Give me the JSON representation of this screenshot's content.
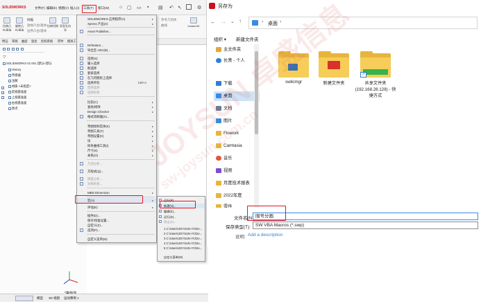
{
  "solidworks": {
    "logo": "SOLIDWORKS",
    "menu": [
      "文件(F)",
      "编辑(E)",
      "视图(V)",
      "插入(I)",
      "工具(T)",
      "窗口(W)"
    ],
    "toolbar": [
      "拉伸凸台/基体",
      "旋转凸台/基体",
      "扫描",
      "放样凸台/基体",
      "边界凸台/基体",
      "拉伸切除",
      "异型孔向导",
      "旋转切除",
      "扫描切除",
      "参考几何体",
      "曲线",
      "Instant3D"
    ],
    "tabs": [
      "特征",
      "草图",
      "曲面",
      "钣金",
      "结构系统",
      "焊件",
      "模具工具",
      "评估"
    ],
    "tree": [
      "SOLIDWORKS 01 001 (默认<默认",
      "History",
      "传感器",
      "注解",
      "材质 <未指定>",
      "前视基准面",
      "上视基准面",
      "右视基准面",
      "原点"
    ],
    "bottom_tabs": [
      "模型",
      "3D 视图",
      "运动算例 1"
    ],
    "axis_label": "*等轴测"
  },
  "tools_menu": {
    "items": [
      {
        "label": "SOLIDWORKS 应用程序(A)",
        "arrow": true
      },
      {
        "label": "Xpress 产品(X)",
        "arrow": true
      },
      {
        "label": "Asset Publisher..."
      },
      {
        "label": "Defeature..."
      },
      {
        "label": "导出至 AEC(B)..."
      },
      {
        "label": "选择(S)"
      },
      {
        "label": "输入选择"
      },
      {
        "label": "框选择"
      },
      {
        "label": "套索选择"
      },
      {
        "label": "在几何图形上选择"
      },
      {
        "label": "选择所有",
        "shortcut": "Ctrl+A"
      },
      {
        "label": "反转选择"
      },
      {
        "label": "选择形状"
      },
      {
        "label": "比较(C)",
        "arrow": true
      },
      {
        "label": "査找/修改",
        "arrow": true
      },
      {
        "label": "Design Checker",
        "arrow": true
      },
      {
        "label": "格式涂刷器(X)..."
      },
      {
        "label": "草图绘制实体(K)",
        "arrow": true
      },
      {
        "label": "草图工具(T)",
        "arrow": true
      },
      {
        "label": "草图设置(S)",
        "arrow": true
      },
      {
        "label": "块",
        "arrow": true
      },
      {
        "label": "样条曲线工具(I)",
        "arrow": true
      },
      {
        "label": "尺寸(S)",
        "arrow": true
      },
      {
        "label": "关系(O)",
        "arrow": true
      },
      {
        "label": "几何分析..."
      },
      {
        "label": "方程式(Q)..."
      },
      {
        "label": "厚度分析..."
      },
      {
        "label": "对称检查..."
      },
      {
        "label": "MBD Dimension",
        "arrow": true
      },
      {
        "label": "宏(A)",
        "arrow": true
      },
      {
        "label": "评估(E)",
        "arrow": true
      },
      {
        "label": "插件(D)..."
      },
      {
        "label": "保存/恢复设置..."
      },
      {
        "label": "自定义(Z)..."
      },
      {
        "label": "选项(P)..."
      },
      {
        "label": "自定义菜单(M)"
      }
    ]
  },
  "macro_submenu": {
    "items": [
      "运行(R)...",
      "新建(N)...",
      "编辑(E)...",
      "运行(D)...",
      "停止(S)...",
      "1 C:\\Users\\JOYSUN-YC\\De...",
      "2 C:\\Users\\JOYSUN-YC\\De...",
      "3 C:\\Users\\JOYSUN-YC\\De...",
      "4 C:\\Users\\JOYSUN-YC\\De...",
      "5 C:\\Users\\JOYSUN-YC\\De...",
      "自定义菜单(M)"
    ]
  },
  "save_dialog": {
    "title": "另存为",
    "breadcrumb": [
      "桌面"
    ],
    "organize": "组织 ▾",
    "new_folder": "新建文件夹",
    "nav": [
      {
        "label": "主文件夹",
        "color": "#e3a53b"
      },
      {
        "label": "长青 - 个人",
        "color": "#2f7fd6"
      },
      {
        "label": "下载",
        "color": "#2f7fd6",
        "pin": true
      },
      {
        "label": "桌面",
        "color": "#3b8be0",
        "pin": true,
        "selected": true
      },
      {
        "label": "文档",
        "color": "#6b7c93",
        "pin": true
      },
      {
        "label": "图片",
        "color": "#3b8be0",
        "pin": true
      },
      {
        "label": "Flowork",
        "color": "#e8b53c",
        "pin": true
      },
      {
        "label": "Camtasia",
        "color": "#e8b53c",
        "pin": true
      },
      {
        "label": "音乐",
        "color": "#e6553a",
        "pin": true
      },
      {
        "label": "视频",
        "color": "#7a4fd0",
        "pin": true
      },
      {
        "label": "月度技术报表",
        "color": "#e8b53c",
        "pin": true
      },
      {
        "label": "2022年度",
        "color": "#e8b53c",
        "pin": true
      },
      {
        "label": "零件",
        "color": "#e8b53c",
        "pin": true
      }
    ],
    "files": [
      {
        "name": "swlicmgr"
      },
      {
        "name": "新建文件夹"
      },
      {
        "name": "共享文件夹 (192.168.28.128) - 快捷方式"
      }
    ],
    "filename_label": "文件名(N):",
    "filename_value": "围号分画",
    "filetype_label": "保存类型(T):",
    "filetype_value": "SW VBA Macros (*.swp)",
    "description_label": "说明:",
    "description_link": "Add a description"
  },
  "watermark": "JOYSUN 卓盛信息",
  "watermark_url": "sw-joysun.com.cn",
  "colors": {
    "highlight": "#e0141e",
    "accent": "#2f7fd6"
  }
}
